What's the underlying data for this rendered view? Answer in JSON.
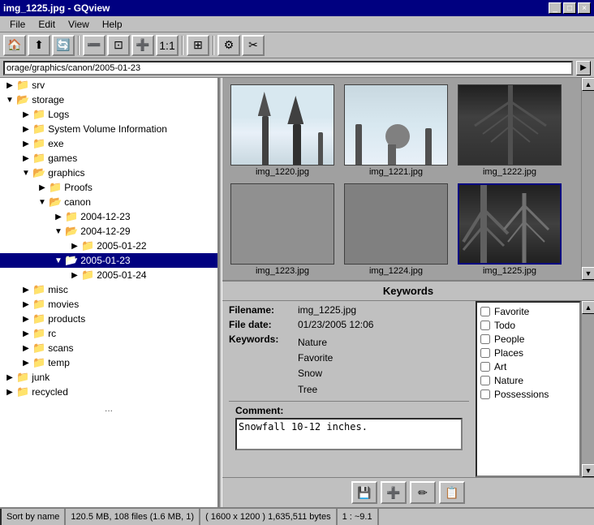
{
  "window": {
    "title": "img_1225.jpg - GQview"
  },
  "titlebar": {
    "buttons": [
      "_",
      "□",
      "×"
    ]
  },
  "menu": {
    "items": [
      "File",
      "Edit",
      "View",
      "Help"
    ]
  },
  "toolbar": {
    "icons": [
      "🏠",
      "⬆",
      "🔄",
      "🔍−",
      "🔍+",
      "⊞",
      "⚙",
      "✂"
    ]
  },
  "address": {
    "value": "orage/graphics/canon/2005-01-23",
    "placeholder": ""
  },
  "tree": {
    "items": [
      {
        "label": "srv",
        "level": 1,
        "expanded": false
      },
      {
        "label": "storage",
        "level": 1,
        "expanded": true
      },
      {
        "label": "Logs",
        "level": 2,
        "expanded": false
      },
      {
        "label": "System Volume Information",
        "level": 2,
        "expanded": false
      },
      {
        "label": "exe",
        "level": 2,
        "expanded": false
      },
      {
        "label": "games",
        "level": 2,
        "expanded": false
      },
      {
        "label": "graphics",
        "level": 2,
        "expanded": true
      },
      {
        "label": "Proofs",
        "level": 3,
        "expanded": false
      },
      {
        "label": "canon",
        "level": 3,
        "expanded": true
      },
      {
        "label": "2004-12-23",
        "level": 4,
        "expanded": false
      },
      {
        "label": "2004-12-29",
        "level": 4,
        "expanded": true
      },
      {
        "label": "2005-01-22",
        "level": 5,
        "expanded": false
      },
      {
        "label": "2005-01-23",
        "level": 4,
        "expanded": false,
        "selected": true
      },
      {
        "label": "2005-01-24",
        "level": 4,
        "expanded": false
      },
      {
        "label": "misc",
        "level": 2,
        "expanded": false
      },
      {
        "label": "movies",
        "level": 2,
        "expanded": false
      },
      {
        "label": "products",
        "level": 2,
        "expanded": false
      },
      {
        "label": "rc",
        "level": 2,
        "expanded": false
      },
      {
        "label": "scans",
        "level": 2,
        "expanded": false
      },
      {
        "label": "temp",
        "level": 2,
        "expanded": false
      },
      {
        "label": "junk",
        "level": 1,
        "expanded": false
      },
      {
        "label": "recycled",
        "level": 1,
        "expanded": false
      }
    ]
  },
  "images": [
    {
      "filename": "img_1220.jpg",
      "selected": false
    },
    {
      "filename": "img_1221.jpg",
      "selected": false
    },
    {
      "filename": "img_1222.jpg",
      "selected": false
    },
    {
      "filename": "img_1223.jpg",
      "selected": false
    },
    {
      "filename": "img_1224.jpg",
      "selected": false
    },
    {
      "filename": "img_1225.jpg",
      "selected": true
    }
  ],
  "keywords_panel": {
    "title": "Keywords",
    "filename_label": "Filename:",
    "filename_value": "img_1225.jpg",
    "filedate_label": "File date:",
    "filedate_value": "01/23/2005 12:06",
    "keywords_label": "Keywords:",
    "assigned_keywords": [
      "Nature",
      "Favorite",
      "Snow",
      "Tree"
    ],
    "checkboxes": [
      {
        "label": "Favorite",
        "checked": false
      },
      {
        "label": "Todo",
        "checked": false
      },
      {
        "label": "People",
        "checked": false
      },
      {
        "label": "Places",
        "checked": false
      },
      {
        "label": "Art",
        "checked": false
      },
      {
        "label": "Nature",
        "checked": false
      },
      {
        "label": "Possessions",
        "checked": false
      }
    ],
    "comment_label": "Comment:",
    "comment_value": "Snowfall 10-12 inches."
  },
  "status": {
    "sort": "Sort by name",
    "fileinfo": "120.5 MB, 108 files (1.6 MB, 1)",
    "dimensions": "( 1600 x 1200 ) 1,635,511 bytes",
    "zoom": "1 : ~9.1"
  }
}
